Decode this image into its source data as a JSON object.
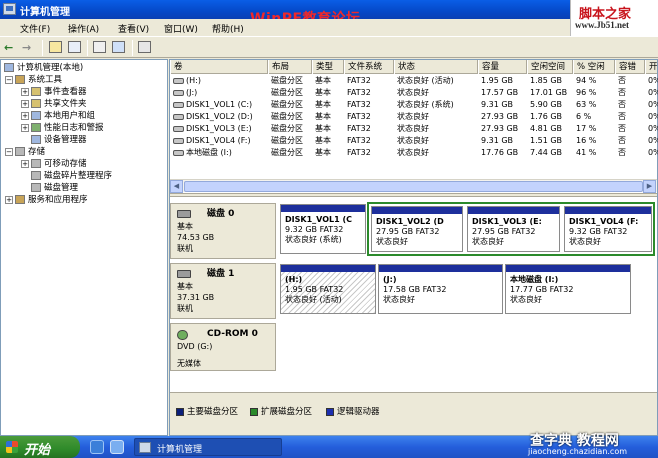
{
  "window": {
    "title": "计算机管理"
  },
  "watermark": {
    "text": "WinPE教育论坛"
  },
  "site_logo": {
    "line1": "脚本之家",
    "line2": "www.Jb51.net"
  },
  "menu": [
    "文件(F)",
    "操作(A)",
    "查看(V)",
    "窗口(W)",
    "帮助(H)"
  ],
  "tree": {
    "root": "计算机管理(本地)",
    "system_tools": "系统工具",
    "event_viewer": "事件查看器",
    "shared_folders": "共享文件夹",
    "local_users": "本地用户和组",
    "perf_logs": "性能日志和警报",
    "device_manager": "设备管理器",
    "storage": "存储",
    "removable": "可移动存储",
    "defrag": "磁盘碎片整理程序",
    "disk_mgmt": "磁盘管理",
    "services": "服务和应用程序"
  },
  "columns": [
    "卷",
    "布局",
    "类型",
    "文件系统",
    "状态",
    "容量",
    "空闲空间",
    "% 空闲",
    "容错",
    "开"
  ],
  "volumes": [
    {
      "name": "(H:)",
      "layout": "磁盘分区",
      "type": "基本",
      "fs": "FAT32",
      "status": "状态良好 (活动)",
      "capacity": "1.95 GB",
      "free": "1.85 GB",
      "pct": "94 %",
      "fault": "否",
      "ov": "0%"
    },
    {
      "name": "(J:)",
      "layout": "磁盘分区",
      "type": "基本",
      "fs": "FAT32",
      "status": "状态良好",
      "capacity": "17.57 GB",
      "free": "17.01 GB",
      "pct": "96 %",
      "fault": "否",
      "ov": "0%"
    },
    {
      "name": "DISK1_VOL1 (C:)",
      "layout": "磁盘分区",
      "type": "基本",
      "fs": "FAT32",
      "status": "状态良好 (系统)",
      "capacity": "9.31 GB",
      "free": "5.90 GB",
      "pct": "63 %",
      "fault": "否",
      "ov": "0%"
    },
    {
      "name": "DISK1_VOL2 (D:)",
      "layout": "磁盘分区",
      "type": "基本",
      "fs": "FAT32",
      "status": "状态良好",
      "capacity": "27.93 GB",
      "free": "1.76 GB",
      "pct": "6 %",
      "fault": "否",
      "ov": "0%"
    },
    {
      "name": "DISK1_VOL3 (E:)",
      "layout": "磁盘分区",
      "type": "基本",
      "fs": "FAT32",
      "status": "状态良好",
      "capacity": "27.93 GB",
      "free": "4.81 GB",
      "pct": "17 %",
      "fault": "否",
      "ov": "0%"
    },
    {
      "name": "DISK1_VOL4 (F:)",
      "layout": "磁盘分区",
      "type": "基本",
      "fs": "FAT32",
      "status": "状态良好",
      "capacity": "9.31 GB",
      "free": "1.51 GB",
      "pct": "16 %",
      "fault": "否",
      "ov": "0%"
    },
    {
      "name": "本地磁盘 (I:)",
      "layout": "磁盘分区",
      "type": "基本",
      "fs": "FAT32",
      "status": "状态良好",
      "capacity": "17.76 GB",
      "free": "7.44 GB",
      "pct": "41 %",
      "fault": "否",
      "ov": "0%"
    }
  ],
  "disks": [
    {
      "name": "磁盘 0",
      "kind": "基本",
      "size": "74.53 GB",
      "state": "联机",
      "partitions": [
        {
          "vol": "DISK1_VOL1 (C",
          "info": "9.32 GB FAT32",
          "status": "状态良好 (系统)"
        },
        {
          "vol": "DISK1_VOL2 (D",
          "info": "27.95 GB FAT32",
          "status": "状态良好"
        },
        {
          "vol": "DISK1_VOL3 (E:",
          "info": "27.95 GB FAT32",
          "status": "状态良好"
        },
        {
          "vol": "DISK1_VOL4 (F:",
          "info": "9.32 GB FAT32",
          "status": "状态良好"
        }
      ]
    },
    {
      "name": "磁盘 1",
      "kind": "基本",
      "size": "37.31 GB",
      "state": "联机",
      "partitions": [
        {
          "vol": "(H:)",
          "info": "1.95 GB FAT32",
          "status": "状态良好 (活动)"
        },
        {
          "vol": "(J:)",
          "info": "17.58 GB FAT32",
          "status": "状态良好"
        },
        {
          "vol": "本地磁盘 (I:)",
          "info": "17.77 GB FAT32",
          "status": "状态良好"
        }
      ]
    },
    {
      "name": "CD-ROM 0",
      "kind": "DVD (G:)",
      "size": "",
      "state": "无媒体"
    }
  ],
  "legend": [
    {
      "label": "主要磁盘分区",
      "color": "#0b1f7a"
    },
    {
      "label": "扩展磁盘分区",
      "color": "#2b8a2b"
    },
    {
      "label": "逻辑驱动器",
      "color": "#1d2fb0"
    }
  ],
  "taskbar": {
    "start": "开始",
    "task": "计算机管理"
  },
  "footer_logo": {
    "line1": "查字典 教程网",
    "line2": "jiaocheng.chazidian.com"
  }
}
